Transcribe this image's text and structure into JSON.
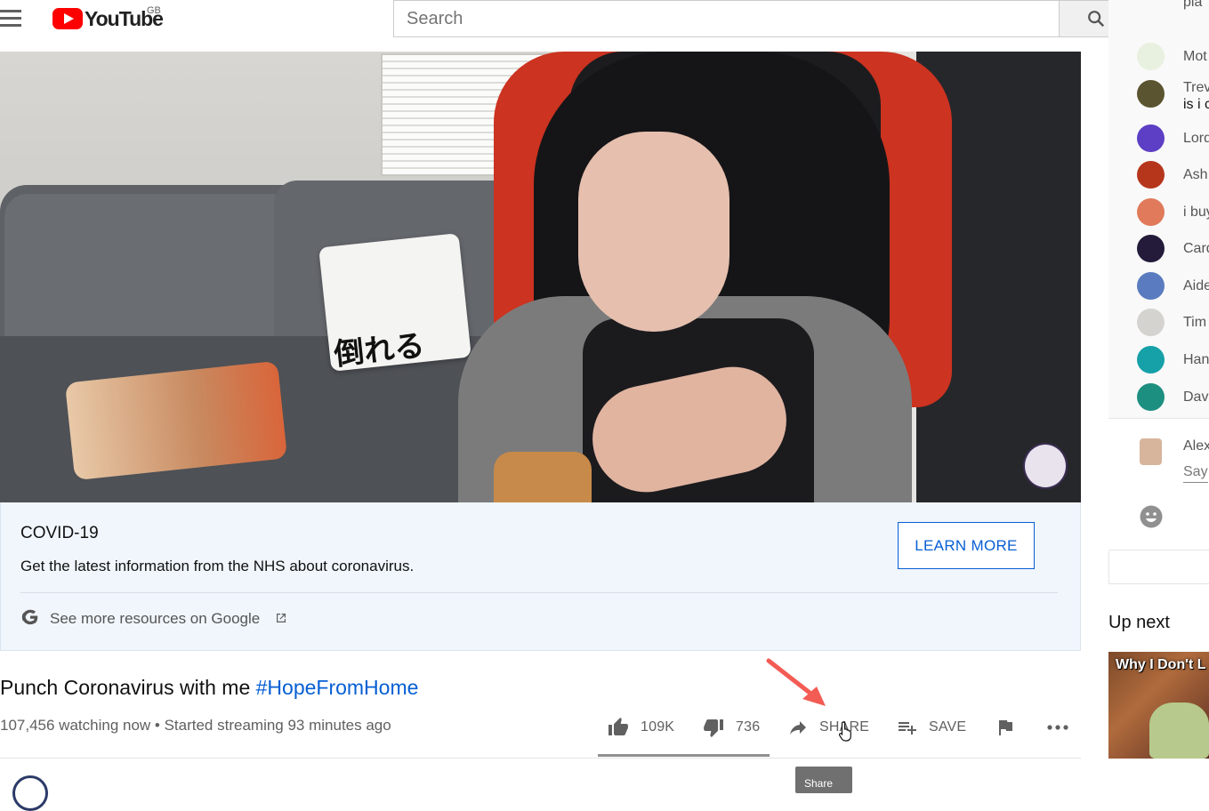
{
  "header": {
    "menu_icon": "hamburger-menu-icon",
    "logo_text": "YouTube",
    "logo_region": "GB",
    "search_placeholder": "Search",
    "search_icon": "search-icon"
  },
  "covid": {
    "title": "COVID-19",
    "text": "Get the latest information from the NHS about coronavirus.",
    "learn_more": "LEARN MORE",
    "see_more": "See more resources on Google"
  },
  "video": {
    "title": "Punch Coronavirus with me ",
    "hashtag": "#HopeFromHome",
    "view_info": "107,456 watching now • Started streaming 93 minutes ago",
    "pillow_text": "倒れる"
  },
  "actions": {
    "likes": "109K",
    "dislikes": "736",
    "share": "SHARE",
    "save": "SAVE",
    "tooltip": "Share",
    "like_ratio": 0.993
  },
  "chat": {
    "messages": [
      {
        "name": "Mot",
        "line2": "",
        "avatar_color": "#e8f0e0"
      },
      {
        "name": "Trev",
        "line2": "is i c",
        "avatar_color": "#5b5430"
      },
      {
        "name": "Lord",
        "line2": "",
        "avatar_color": "#5c3fc4"
      },
      {
        "name": "Ash",
        "line2": "",
        "avatar_color": "#b6361b"
      },
      {
        "name": "i buy",
        "line2": "",
        "avatar_color": "#e07a5a"
      },
      {
        "name": "Card",
        "line2": "",
        "avatar_color": "#241a3a"
      },
      {
        "name": "Aide",
        "line2": "",
        "avatar_color": "#5a7bbf"
      },
      {
        "name": "Tim",
        "line2": "",
        "avatar_color": "#d5d3cf"
      },
      {
        "name": "Han",
        "line2": "",
        "avatar_color": "#16a0a8"
      },
      {
        "name": "Dav",
        "line2": "",
        "avatar_color": "#1d8f80"
      }
    ],
    "top_partial": "pla",
    "input_name": "Alex",
    "input_placeholder": "Say"
  },
  "up_next": {
    "heading": "Up next",
    "thumb_title": "Why I Don't L"
  },
  "colors": {
    "accent": "#065fd4",
    "brand": "#ff0000"
  }
}
